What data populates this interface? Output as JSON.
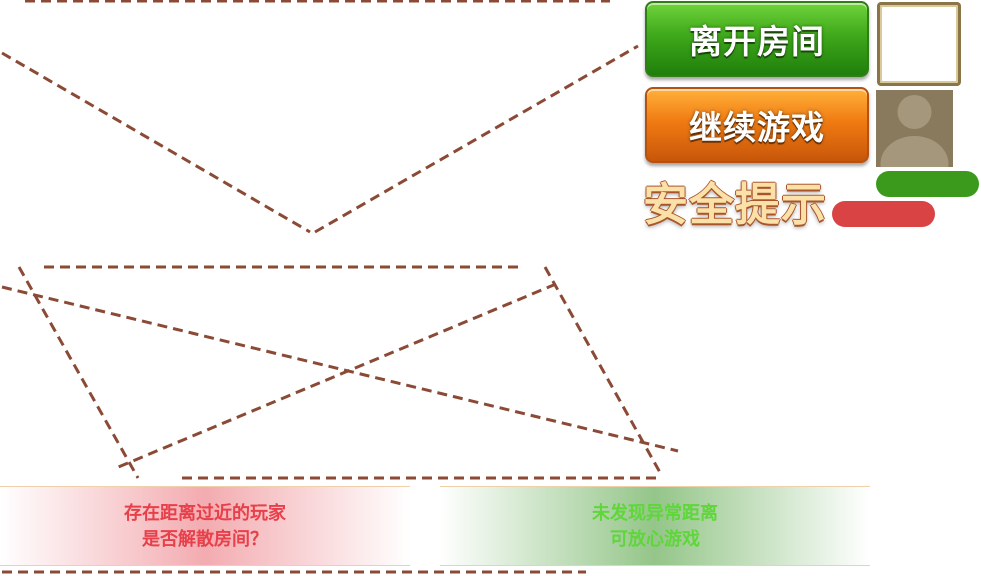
{
  "buttons": {
    "leave_room": "离开房间",
    "continue_game": "继续游戏"
  },
  "safety": {
    "title": "安全提示"
  },
  "messages": {
    "warning_line1": "存在距离过近的玩家",
    "warning_line2": "是否解散房间？",
    "safe_line1": "未发现异常距离",
    "safe_line2": "可放心游戏"
  },
  "colors": {
    "line": "#8b4a35",
    "green_button": "#3fa81b",
    "orange_button": "#f07b12",
    "warning_text": "#e8404b",
    "safe_text": "#5fd63a",
    "green_bar": "#3b9a1c",
    "red_bar": "#d94343"
  },
  "icons": {
    "avatar": "default-user-silhouette"
  }
}
